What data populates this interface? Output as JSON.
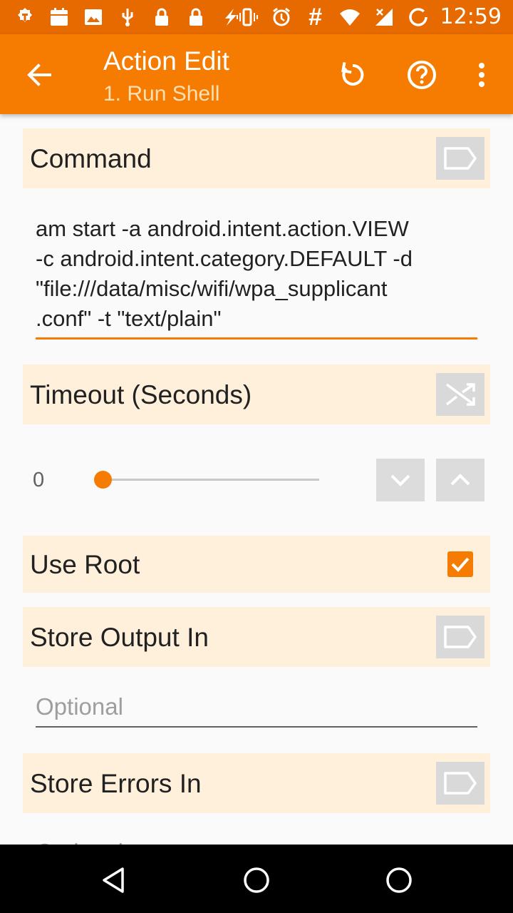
{
  "status_bar": {
    "time": "12:59",
    "left_icons": [
      "tasker-icon",
      "calendar-icon",
      "image-icon",
      "usb-icon",
      "lock-icon",
      "lock-icon",
      "flash-icon"
    ],
    "right_icons": [
      "vibrate-icon",
      "alarm-icon",
      "hash-icon",
      "wifi-icon",
      "signal-icon",
      "battery-saver-icon"
    ],
    "hash_glyph": "#"
  },
  "app_bar": {
    "title": "Action Edit",
    "subtitle": "1. Run Shell"
  },
  "command": {
    "label": "Command",
    "value_lines": [
      "am start -a android.intent.action.VIEW",
      "-c android.intent.category.DEFAULT -d",
      "\"file:///data/misc/wifi/wpa_supplicant",
      ".conf\" -t \"text/plain\""
    ]
  },
  "timeout": {
    "label": "Timeout (Seconds)",
    "value": "0"
  },
  "use_root": {
    "label": "Use Root",
    "checked": true
  },
  "store_output": {
    "label": "Store Output In",
    "placeholder": "Optional"
  },
  "store_errors": {
    "label": "Store Errors In",
    "placeholder": "Optional"
  },
  "colors": {
    "accent": "#F57C00",
    "status_bar": "#E66A00",
    "row_background": "#FFF0DC"
  }
}
